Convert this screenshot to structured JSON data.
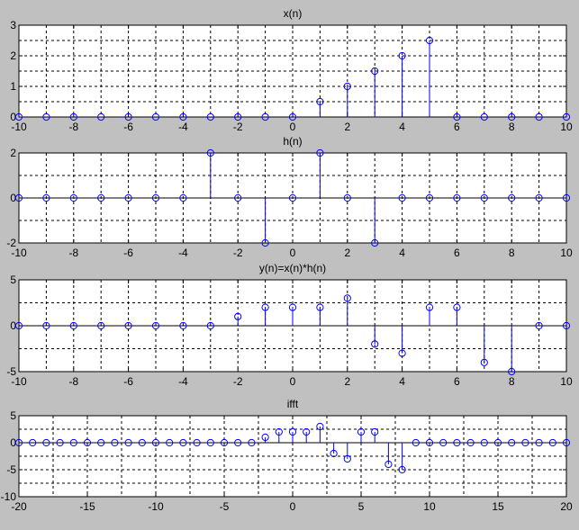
{
  "figure": {
    "background": "#c0c0c0",
    "axes_background": "#ffffff",
    "stem_color": "#0000ff"
  },
  "chart_data": [
    {
      "type": "stem",
      "title": "x(n)",
      "xlim": [
        -10,
        10
      ],
      "ylim": [
        0,
        3
      ],
      "xticks": [
        -10,
        -8,
        -6,
        -4,
        -2,
        0,
        2,
        4,
        6,
        8,
        10
      ],
      "yticks": [
        0,
        1,
        2,
        3
      ],
      "grid": true,
      "x": [
        -10,
        -9,
        -8,
        -7,
        -6,
        -5,
        -4,
        -3,
        -2,
        -1,
        0,
        1,
        2,
        3,
        4,
        5,
        6,
        7,
        8,
        9,
        10
      ],
      "y": [
        0,
        0,
        0,
        0,
        0,
        0,
        0,
        0,
        0,
        0,
        0,
        0.5,
        1,
        1.5,
        2,
        2.5,
        0,
        0,
        0,
        0,
        0
      ]
    },
    {
      "type": "stem",
      "title": "h(n)",
      "xlim": [
        -10,
        10
      ],
      "ylim": [
        -2,
        2
      ],
      "xticks": [
        -10,
        -8,
        -6,
        -4,
        -2,
        0,
        2,
        4,
        6,
        8,
        10
      ],
      "yticks": [
        -2,
        0,
        2
      ],
      "grid": true,
      "x": [
        -10,
        -9,
        -8,
        -7,
        -6,
        -5,
        -4,
        -3,
        -2,
        -1,
        0,
        1,
        2,
        3,
        4,
        5,
        6,
        7,
        8,
        9,
        10
      ],
      "y": [
        0,
        0,
        0,
        0,
        0,
        0,
        0,
        2,
        0,
        -2,
        0,
        2,
        0,
        -2,
        0,
        0,
        0,
        0,
        0,
        0,
        0
      ]
    },
    {
      "type": "stem",
      "title": "y(n)=x(n)*h(n)",
      "xlim": [
        -10,
        10
      ],
      "ylim": [
        -5,
        5
      ],
      "xticks": [
        -10,
        -8,
        -6,
        -4,
        -2,
        0,
        2,
        4,
        6,
        8,
        10
      ],
      "yticks": [
        -5,
        0,
        5
      ],
      "grid": true,
      "x": [
        -10,
        -9,
        -8,
        -7,
        -6,
        -5,
        -4,
        -3,
        -2,
        -1,
        0,
        1,
        2,
        3,
        4,
        5,
        6,
        7,
        8,
        9,
        10
      ],
      "y": [
        0,
        0,
        0,
        0,
        0,
        0,
        0,
        0,
        1,
        2,
        2,
        2,
        3,
        -2,
        -3,
        2,
        2,
        -4,
        -5,
        0,
        0
      ]
    },
    {
      "type": "stem",
      "title": "ifft",
      "xlim": [
        -20,
        20
      ],
      "ylim": [
        -10,
        5
      ],
      "xticks": [
        -20,
        -15,
        -10,
        -5,
        0,
        5,
        10,
        15,
        20
      ],
      "yticks": [
        -10,
        -5,
        0,
        5
      ],
      "grid": true,
      "x": [
        -20,
        -19,
        -18,
        -17,
        -16,
        -15,
        -14,
        -13,
        -12,
        -11,
        -10,
        -9,
        -8,
        -7,
        -6,
        -5,
        -4,
        -3,
        -2,
        -1,
        0,
        1,
        2,
        3,
        4,
        5,
        6,
        7,
        8,
        9,
        10,
        11,
        12,
        13,
        14,
        15,
        16,
        17,
        18,
        19,
        20
      ],
      "y": [
        0,
        0,
        0,
        0,
        0,
        0,
        0,
        0,
        0,
        0,
        0,
        0,
        0,
        0,
        0,
        0,
        0,
        0,
        1,
        2,
        2,
        2,
        3,
        -2,
        -3,
        2,
        2,
        -4,
        -5,
        0,
        0,
        0,
        0,
        0,
        0,
        0,
        0,
        0,
        0,
        0,
        0
      ]
    }
  ]
}
